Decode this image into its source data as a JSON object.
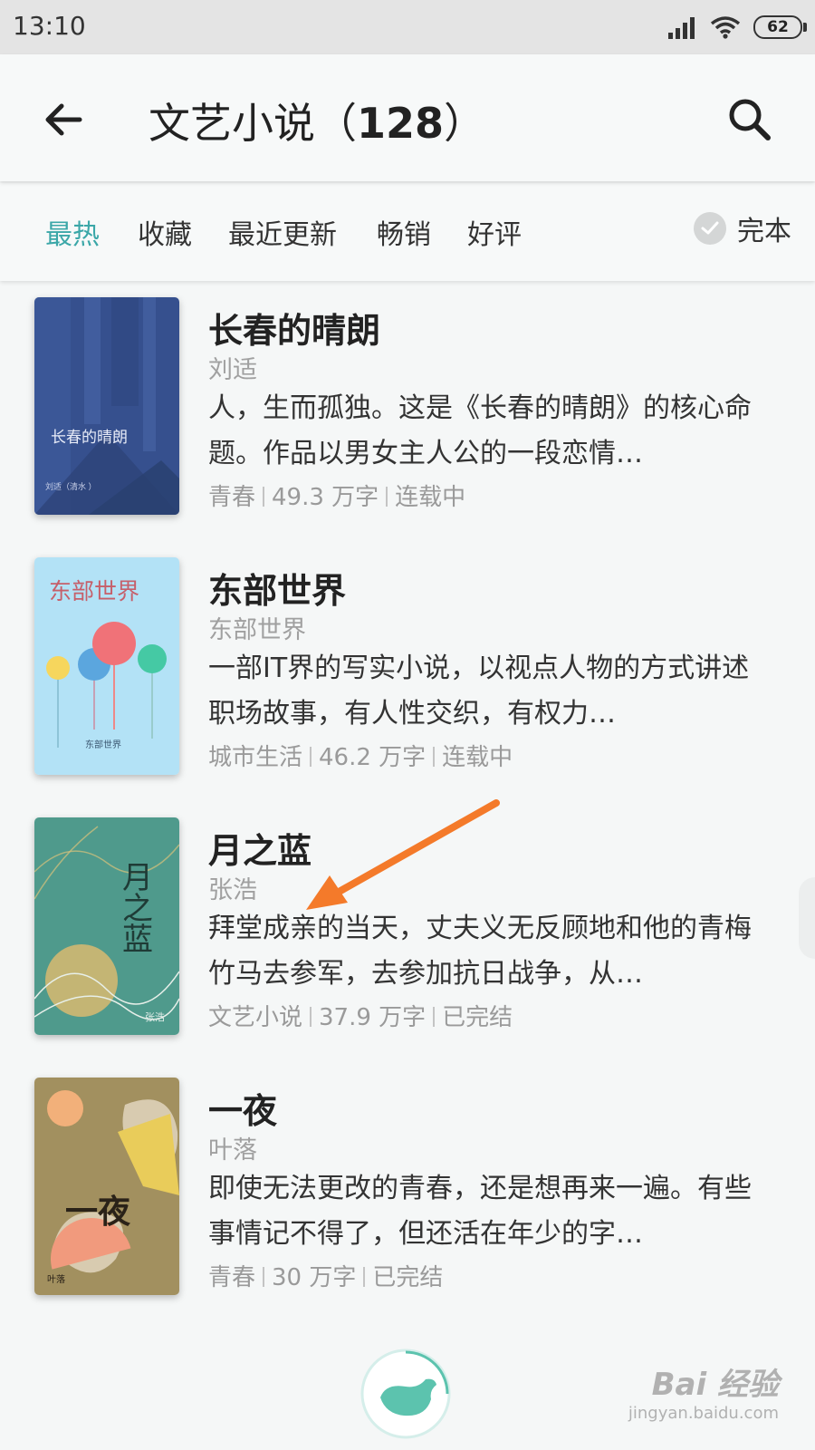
{
  "status_bar": {
    "time": "13:10",
    "battery": "62"
  },
  "app_bar": {
    "title": "文艺小说（",
    "count": "128",
    "title_end": "）"
  },
  "filters": {
    "tabs": [
      "最热",
      "收藏",
      "最近更新",
      "畅销",
      "好评"
    ],
    "active": "最热",
    "complete_label": "完本"
  },
  "books": [
    {
      "title": "长春的晴朗",
      "author": "刘适",
      "description": "人，生而孤独。这是《长春的晴朗》的核心命题。作品以男女主人公的一段恋情…",
      "genre": "青春",
      "words": "49.3 万字",
      "status": "连载中",
      "cover_title": "长春的晴朗",
      "cover_sub": "刘适（清水 ）"
    },
    {
      "title": "东部世界",
      "author": "东部世界",
      "description": "一部IT界的写实小说，以视点人物的方式讲述职场故事，有人性交织，有权力…",
      "genre": "城市生活",
      "words": "46.2 万字",
      "status": "连载中",
      "cover_title": "东部世界",
      "cover_sub": "东部世界"
    },
    {
      "title": "月之蓝",
      "author": "张浩",
      "description": "拜堂成亲的当天，丈夫义无反顾地和他的青梅竹马去参军，去参加抗日战争，从…",
      "genre": "文艺小说",
      "words": "37.9 万字",
      "status": "已完结",
      "cover_title": "月之蓝",
      "cover_sub": "张浩"
    },
    {
      "title": "一夜",
      "author": "叶落",
      "description": "即使无法更改的青春，还是想再来一遍。有些事情记不得了，但还活在年少的字…",
      "genre": "青春",
      "words": "30 万字",
      "status": "已完结",
      "cover_title": "一夜",
      "cover_sub": "叶落"
    }
  ],
  "watermark": {
    "main": "Bai 经验",
    "sub": "jingyan.baidu.com"
  },
  "colors": {
    "accent": "#3ba7a8",
    "arrow": "#f47a2a"
  }
}
